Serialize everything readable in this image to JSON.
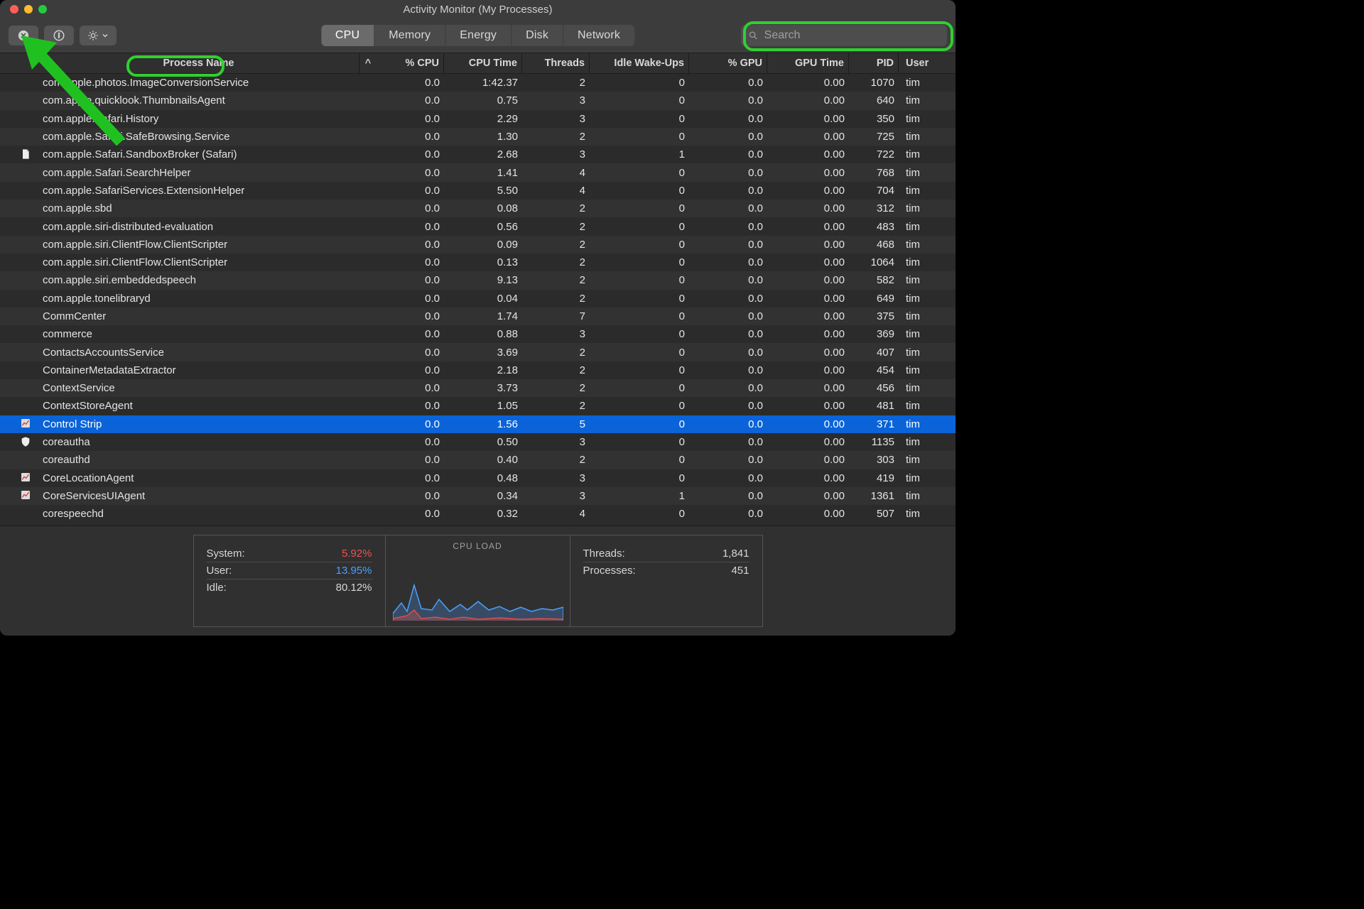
{
  "window": {
    "title": "Activity Monitor (My Processes)"
  },
  "toolbar": {
    "tabs": [
      "CPU",
      "Memory",
      "Energy",
      "Disk",
      "Network"
    ],
    "active_tab": 0,
    "search_placeholder": "Search"
  },
  "columns": {
    "name": "Process Name",
    "cpu": "% CPU",
    "time": "CPU Time",
    "threads": "Threads",
    "idle": "Idle Wake-Ups",
    "gpu": "% GPU",
    "gputime": "GPU Time",
    "pid": "PID",
    "user": "User",
    "sort_asc_glyph": "^"
  },
  "rows": [
    {
      "name": "com.apple.photos.ImageConversionService",
      "cpu": "0.0",
      "time": "1:42.37",
      "thr": "2",
      "idle": "0",
      "gpu": "0.0",
      "gput": "0.00",
      "pid": "1070",
      "user": "tim"
    },
    {
      "name": "com.apple.quicklook.ThumbnailsAgent",
      "cpu": "0.0",
      "time": "0.75",
      "thr": "3",
      "idle": "0",
      "gpu": "0.0",
      "gput": "0.00",
      "pid": "640",
      "user": "tim"
    },
    {
      "name": "com.apple.Safari.History",
      "cpu": "0.0",
      "time": "2.29",
      "thr": "3",
      "idle": "0",
      "gpu": "0.0",
      "gput": "0.00",
      "pid": "350",
      "user": "tim"
    },
    {
      "name": "com.apple.Safari.SafeBrowsing.Service",
      "cpu": "0.0",
      "time": "1.30",
      "thr": "2",
      "idle": "0",
      "gpu": "0.0",
      "gput": "0.00",
      "pid": "725",
      "user": "tim"
    },
    {
      "name": "com.apple.Safari.SandboxBroker (Safari)",
      "cpu": "0.0",
      "time": "2.68",
      "thr": "3",
      "idle": "1",
      "gpu": "0.0",
      "gput": "0.00",
      "pid": "722",
      "user": "tim",
      "icon": "doc"
    },
    {
      "name": "com.apple.Safari.SearchHelper",
      "cpu": "0.0",
      "time": "1.41",
      "thr": "4",
      "idle": "0",
      "gpu": "0.0",
      "gput": "0.00",
      "pid": "768",
      "user": "tim"
    },
    {
      "name": "com.apple.SafariServices.ExtensionHelper",
      "cpu": "0.0",
      "time": "5.50",
      "thr": "4",
      "idle": "0",
      "gpu": "0.0",
      "gput": "0.00",
      "pid": "704",
      "user": "tim"
    },
    {
      "name": "com.apple.sbd",
      "cpu": "0.0",
      "time": "0.08",
      "thr": "2",
      "idle": "0",
      "gpu": "0.0",
      "gput": "0.00",
      "pid": "312",
      "user": "tim"
    },
    {
      "name": "com.apple.siri-distributed-evaluation",
      "cpu": "0.0",
      "time": "0.56",
      "thr": "2",
      "idle": "0",
      "gpu": "0.0",
      "gput": "0.00",
      "pid": "483",
      "user": "tim"
    },
    {
      "name": "com.apple.siri.ClientFlow.ClientScripter",
      "cpu": "0.0",
      "time": "0.09",
      "thr": "2",
      "idle": "0",
      "gpu": "0.0",
      "gput": "0.00",
      "pid": "468",
      "user": "tim"
    },
    {
      "name": "com.apple.siri.ClientFlow.ClientScripter",
      "cpu": "0.0",
      "time": "0.13",
      "thr": "2",
      "idle": "0",
      "gpu": "0.0",
      "gput": "0.00",
      "pid": "1064",
      "user": "tim"
    },
    {
      "name": "com.apple.siri.embeddedspeech",
      "cpu": "0.0",
      "time": "9.13",
      "thr": "2",
      "idle": "0",
      "gpu": "0.0",
      "gput": "0.00",
      "pid": "582",
      "user": "tim"
    },
    {
      "name": "com.apple.tonelibraryd",
      "cpu": "0.0",
      "time": "0.04",
      "thr": "2",
      "idle": "0",
      "gpu": "0.0",
      "gput": "0.00",
      "pid": "649",
      "user": "tim"
    },
    {
      "name": "CommCenter",
      "cpu": "0.0",
      "time": "1.74",
      "thr": "7",
      "idle": "0",
      "gpu": "0.0",
      "gput": "0.00",
      "pid": "375",
      "user": "tim"
    },
    {
      "name": "commerce",
      "cpu": "0.0",
      "time": "0.88",
      "thr": "3",
      "idle": "0",
      "gpu": "0.0",
      "gput": "0.00",
      "pid": "369",
      "user": "tim"
    },
    {
      "name": "ContactsAccountsService",
      "cpu": "0.0",
      "time": "3.69",
      "thr": "2",
      "idle": "0",
      "gpu": "0.0",
      "gput": "0.00",
      "pid": "407",
      "user": "tim"
    },
    {
      "name": "ContainerMetadataExtractor",
      "cpu": "0.0",
      "time": "2.18",
      "thr": "2",
      "idle": "0",
      "gpu": "0.0",
      "gput": "0.00",
      "pid": "454",
      "user": "tim"
    },
    {
      "name": "ContextService",
      "cpu": "0.0",
      "time": "3.73",
      "thr": "2",
      "idle": "0",
      "gpu": "0.0",
      "gput": "0.00",
      "pid": "456",
      "user": "tim"
    },
    {
      "name": "ContextStoreAgent",
      "cpu": "0.0",
      "time": "1.05",
      "thr": "2",
      "idle": "0",
      "gpu": "0.0",
      "gput": "0.00",
      "pid": "481",
      "user": "tim"
    },
    {
      "name": "Control Strip",
      "cpu": "0.0",
      "time": "1.56",
      "thr": "5",
      "idle": "0",
      "gpu": "0.0",
      "gput": "0.00",
      "pid": "371",
      "user": "tim",
      "selected": true,
      "icon": "chart"
    },
    {
      "name": "coreautha",
      "cpu": "0.0",
      "time": "0.50",
      "thr": "3",
      "idle": "0",
      "gpu": "0.0",
      "gput": "0.00",
      "pid": "1135",
      "user": "tim",
      "icon": "shield"
    },
    {
      "name": "coreauthd",
      "cpu": "0.0",
      "time": "0.40",
      "thr": "2",
      "idle": "0",
      "gpu": "0.0",
      "gput": "0.00",
      "pid": "303",
      "user": "tim"
    },
    {
      "name": "CoreLocationAgent",
      "cpu": "0.0",
      "time": "0.48",
      "thr": "3",
      "idle": "0",
      "gpu": "0.0",
      "gput": "0.00",
      "pid": "419",
      "user": "tim",
      "icon": "chart"
    },
    {
      "name": "CoreServicesUIAgent",
      "cpu": "0.0",
      "time": "0.34",
      "thr": "3",
      "idle": "1",
      "gpu": "0.0",
      "gput": "0.00",
      "pid": "1361",
      "user": "tim",
      "icon": "chart"
    },
    {
      "name": "corespeechd",
      "cpu": "0.0",
      "time": "0.32",
      "thr": "4",
      "idle": "0",
      "gpu": "0.0",
      "gput": "0.00",
      "pid": "507",
      "user": "tim"
    }
  ],
  "footer": {
    "system_label": "System:",
    "system_val": "5.92%",
    "system_color": "#f05050",
    "user_label": "User:",
    "user_val": "13.95%",
    "user_color": "#4aa0ff",
    "idle_label": "Idle:",
    "idle_val": "80.12%",
    "cpu_load_label": "CPU LOAD",
    "threads_label": "Threads:",
    "threads_val": "1,841",
    "processes_label": "Processes:",
    "processes_val": "451"
  }
}
